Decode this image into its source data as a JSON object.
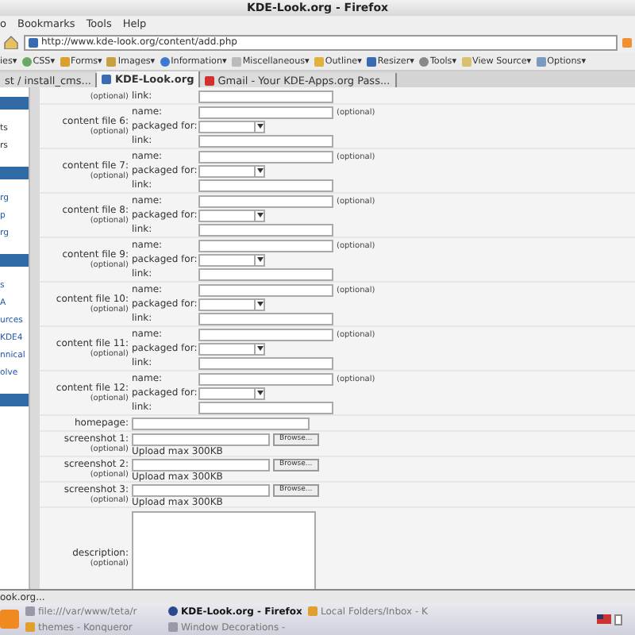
{
  "window": {
    "title": "KDE-Look.org - Firefox"
  },
  "menu": [
    "o",
    "Bookmarks",
    "Tools",
    "Help"
  ],
  "url": "http://www.kde-look.org/content/add.php",
  "toolbar": [
    "ies▾",
    "CSS▾",
    "Forms▾",
    "Images▾",
    "Information▾",
    "Miscellaneous▾",
    "Outline▾",
    "Resizer▾",
    "Tools▾",
    "View Source▾",
    "Options▾"
  ],
  "tabs": [
    {
      "label": "st / install_cms...",
      "selected": false
    },
    {
      "label": "KDE-Look.org",
      "selected": true
    },
    {
      "label": "Gmail - Your KDE-Apps.org Pass...",
      "selected": false
    }
  ],
  "sidebar": [
    {
      "kind": "header"
    },
    {
      "kind": "text",
      "text": "ts"
    },
    {
      "kind": "text",
      "text": "rs"
    },
    {
      "kind": "header"
    },
    {
      "kind": "link",
      "text": "rg"
    },
    {
      "kind": "link",
      "text": "p"
    },
    {
      "kind": "link",
      "text": "rg"
    },
    {
      "kind": "header"
    },
    {
      "kind": "link",
      "text": "s"
    },
    {
      "kind": "link",
      "text": "A"
    },
    {
      "kind": "link",
      "text": "urces"
    },
    {
      "kind": "link",
      "text": "KDE4"
    },
    {
      "kind": "link",
      "text": "nnical"
    },
    {
      "kind": "link",
      "text": "olve"
    },
    {
      "kind": "header"
    }
  ],
  "form": {
    "partial_block": {
      "note": "(optional)",
      "link_label": "link:"
    },
    "content_files": [
      {
        "label": "content file 6:",
        "note": "(optional)",
        "name_label": "name:",
        "name_note": "(optional)",
        "packaged_label": "packaged for:",
        "link_label": "link:"
      },
      {
        "label": "content file 7:",
        "note": "(optional)",
        "name_label": "name:",
        "name_note": "(optional)",
        "packaged_label": "packaged for:",
        "link_label": "link:"
      },
      {
        "label": "content file 8:",
        "note": "(optional)",
        "name_label": "name:",
        "name_note": "(optional)",
        "packaged_label": "packaged for:",
        "link_label": "link:"
      },
      {
        "label": "content file 9:",
        "note": "(optional)",
        "name_label": "name:",
        "name_note": "(optional)",
        "packaged_label": "packaged for:",
        "link_label": "link:"
      },
      {
        "label": "content file 10:",
        "note": "(optional)",
        "name_label": "name:",
        "name_note": "(optional)",
        "packaged_label": "packaged for:",
        "link_label": "link:"
      },
      {
        "label": "content file 11:",
        "note": "(optional)",
        "name_label": "name:",
        "name_note": "(optional)",
        "packaged_label": "packaged for:",
        "link_label": "link:"
      },
      {
        "label": "content file 12:",
        "note": "(optional)",
        "name_label": "name:",
        "name_note": "(optional)",
        "packaged_label": "packaged for:",
        "link_label": "link:"
      }
    ],
    "homepage_label": "homepage:",
    "screenshots": [
      {
        "label": "screenshot 1:",
        "note": "(optional)",
        "button": "Browse...",
        "hint": "Upload max 300KB"
      },
      {
        "label": "screenshot 2:",
        "note": "(optional)",
        "button": "Browse...",
        "hint": "Upload max 300KB"
      },
      {
        "label": "screenshot 3:",
        "note": "(optional)",
        "button": "Browse...",
        "hint": "Upload max 300KB"
      }
    ],
    "description": {
      "label": "description:",
      "note": "(optional)"
    }
  },
  "status_bar": "ook.org...",
  "taskbar": {
    "row_1": [
      "file:///var/www/teta/r",
      "KDE-Look.org - Firefox",
      "Local Folders/Inbox - K"
    ],
    "row_2": [
      "themes - Konqueror",
      "Window Decorations - "
    ]
  }
}
